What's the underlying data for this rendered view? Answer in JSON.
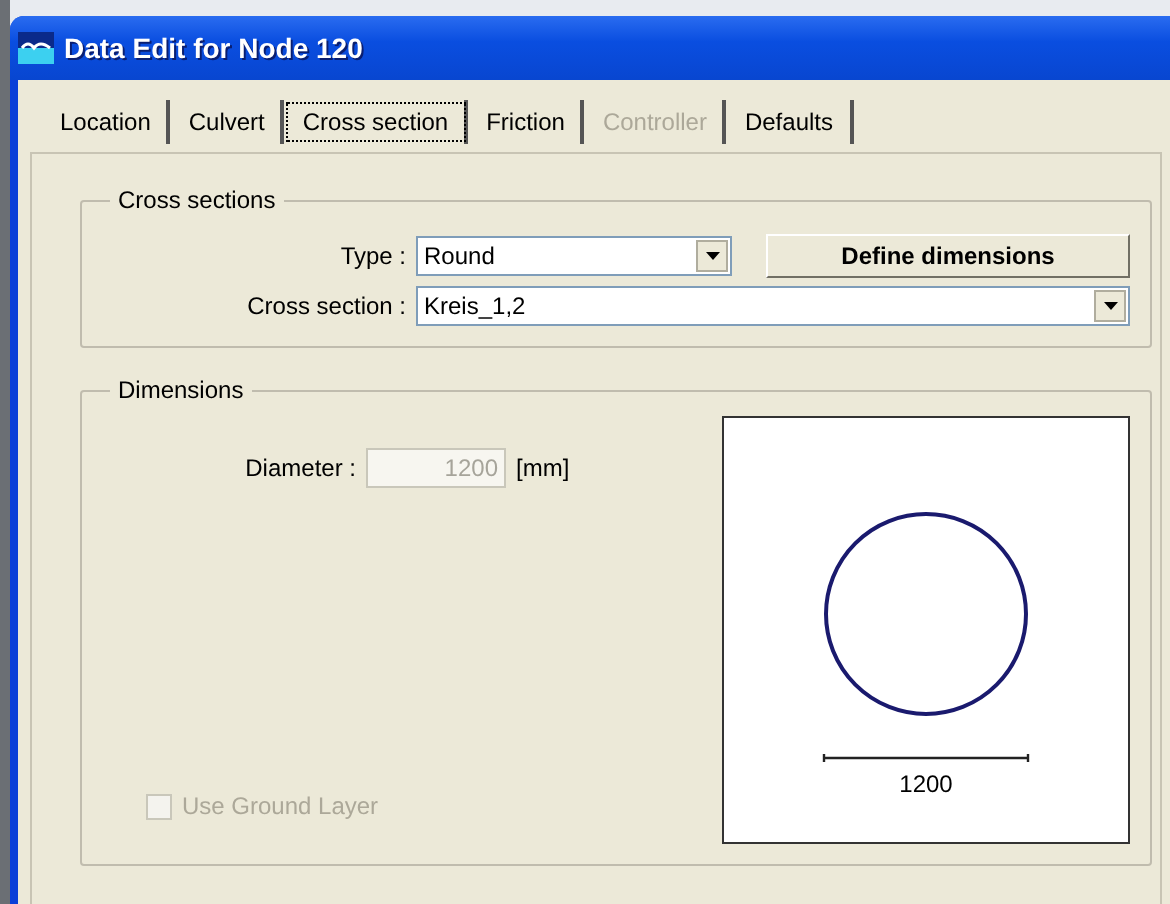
{
  "window": {
    "title": "Data Edit for Node 120"
  },
  "tabs": [
    {
      "label": "Location",
      "selected": false,
      "disabled": false
    },
    {
      "label": "Culvert",
      "selected": false,
      "disabled": false
    },
    {
      "label": "Cross section",
      "selected": true,
      "disabled": false
    },
    {
      "label": "Friction",
      "selected": false,
      "disabled": false
    },
    {
      "label": "Controller",
      "selected": false,
      "disabled": true
    },
    {
      "label": "Defaults",
      "selected": false,
      "disabled": false
    }
  ],
  "cross_sections": {
    "title": "Cross sections",
    "type_label": "Type :",
    "type_value": "Round",
    "define_button": {
      "label": "Define dimensions"
    },
    "section_label": "Cross section :",
    "section_value": "Kreis_1,2"
  },
  "dimensions": {
    "title": "Dimensions",
    "diameter_label": "Diameter :",
    "diameter_value": "1200",
    "diameter_disabled": true,
    "unit": "[mm]",
    "preview_label": "1200",
    "ground_layer": {
      "label": "Use Ground Layer",
      "checked": false,
      "disabled": true
    }
  }
}
